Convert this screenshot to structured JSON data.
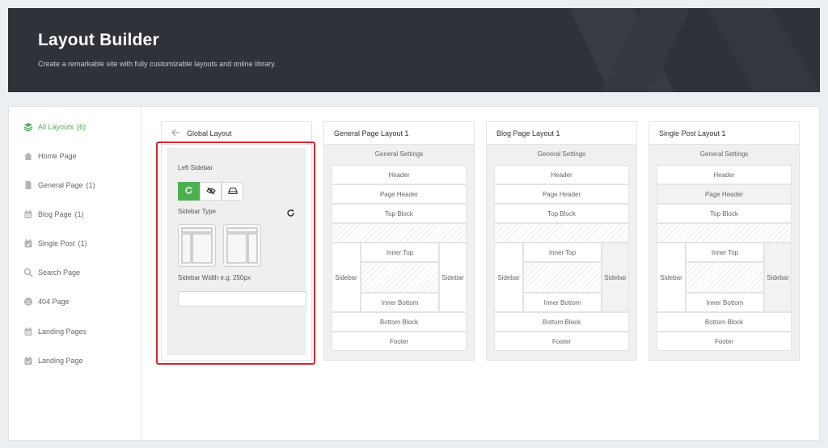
{
  "header": {
    "title": "Layout Builder",
    "subtitle": "Create a remarkable site with fully customizable layouts and online library."
  },
  "sidebar": {
    "items": [
      {
        "label": "All Layouts",
        "count": "(6)",
        "icon": "layers-icon",
        "active": true
      },
      {
        "label": "Home Page",
        "count": "",
        "icon": "home-icon"
      },
      {
        "label": "General Page",
        "count": "(1)",
        "icon": "page-icon"
      },
      {
        "label": "Blog Page",
        "count": "(1)",
        "icon": "calendar-icon"
      },
      {
        "label": "Single Post",
        "count": "(1)",
        "icon": "calendar-check-icon"
      },
      {
        "label": "Search Page",
        "count": "",
        "icon": "search-icon"
      },
      {
        "label": "404 Page",
        "count": "",
        "icon": "sad-face-icon"
      },
      {
        "label": "Landing Pages",
        "count": "",
        "icon": "calendar-icon"
      },
      {
        "label": "Landing Page",
        "count": "",
        "icon": "calendar-check-icon"
      }
    ]
  },
  "global_layout": {
    "title": "Global Layout",
    "left_sidebar_label": "Left Sidebar",
    "sidebar_type_label": "Sidebar Type",
    "sidebar_width_label": "Sidebar Width e.g: 250px",
    "sidebar_width_value": "",
    "toggles": [
      "reset-icon",
      "eye-off-icon",
      "drive-icon"
    ]
  },
  "layouts": [
    {
      "title": "General Page Layout 1",
      "general_settings": "General Settings",
      "header": "Header",
      "page_header": "Page Header",
      "top_block": "Top Block",
      "inner_top": "Inner Top",
      "inner_bottom": "Inner Bottom",
      "sidebar_left": "Sidebar",
      "sidebar_right": "Sidebar",
      "bottom_block": "Bottom Block",
      "footer": "Footer"
    },
    {
      "title": "Blog Page Layout 1",
      "general_settings": "General Settings",
      "header": "Header",
      "page_header": "Page Header",
      "top_block": "Top Block",
      "inner_top": "Inner Top",
      "inner_bottom": "Inner Bottom",
      "sidebar_left": "Sidebar",
      "sidebar_right": "Sidebar",
      "bottom_block": "Bottom Block",
      "footer": "Footer"
    },
    {
      "title": "Single Post Layout 1",
      "general_settings": "General Settings",
      "header": "Header",
      "page_header": "Page Header",
      "top_block": "Top Block",
      "inner_top": "Inner Top",
      "inner_bottom": "Inner Bottom",
      "sidebar_left": "Sidebar",
      "sidebar_right": "Sidebar",
      "bottom_block": "Bottom Block",
      "footer": "Footer"
    }
  ],
  "colors": {
    "accent": "#4caf50",
    "header_bg": "#2f3238",
    "highlight": "#d7262b"
  }
}
